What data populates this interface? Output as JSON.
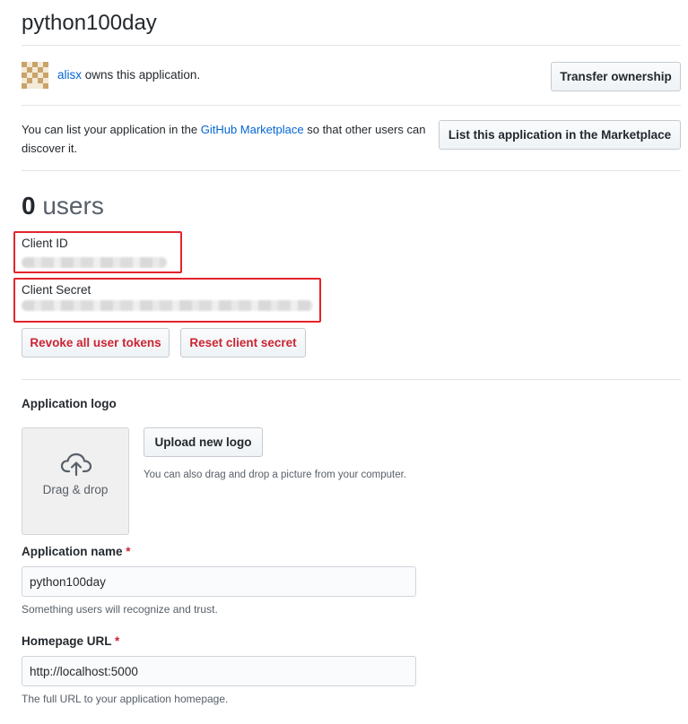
{
  "app": {
    "title": "python100day"
  },
  "owner": {
    "username": "alisx",
    "owns_text": " owns this application.",
    "transfer_label": "Transfer ownership"
  },
  "marketplace": {
    "text_before": "You can list your application in the ",
    "link_text": "GitHub Marketplace",
    "text_after": " so that other users can discover it.",
    "button_label": "List this application in the Marketplace"
  },
  "stats": {
    "users_count": "0",
    "users_label": "users"
  },
  "credentials": {
    "client_id_label": "Client ID",
    "client_secret_label": "Client Secret",
    "revoke_label": "Revoke all user tokens",
    "reset_label": "Reset client secret"
  },
  "logo": {
    "section_label": "Application logo",
    "drop_label": "Drag & drop",
    "upload_label": "Upload new logo",
    "upload_hint": "You can also drag and drop a picture from your computer."
  },
  "form": {
    "app_name_label": "Application name",
    "app_name_value": "python100day",
    "app_name_hint": "Something users will recognize and trust.",
    "homepage_label": "Homepage URL",
    "homepage_value": "http://localhost:5000",
    "homepage_hint": "The full URL to your application homepage.",
    "required_mark": "*"
  },
  "colors": {
    "link": "#0366d6",
    "danger": "#cb2431",
    "highlight_box": "#e3242b",
    "avatar": "#c9a36a"
  }
}
